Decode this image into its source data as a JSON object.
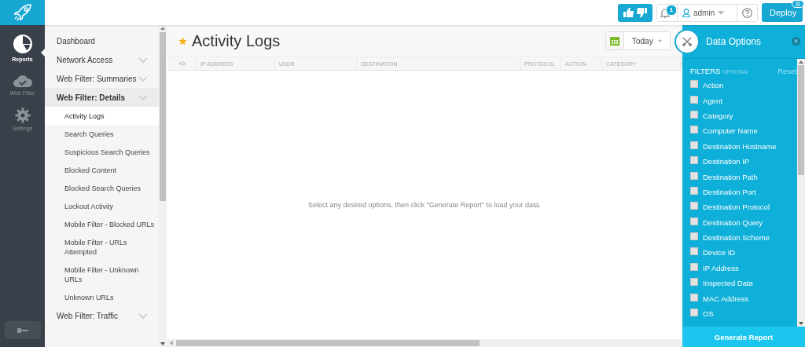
{
  "topbar": {
    "notification_count": "1",
    "user": "admin",
    "deploy_button": "Deploy"
  },
  "rail": [
    {
      "label": "Reports",
      "selected": true
    },
    {
      "label": "Web Filter",
      "selected": false
    },
    {
      "label": "Settings",
      "selected": false
    }
  ],
  "nav": [
    {
      "label": "Dashboard",
      "expandable": false,
      "expanded": false
    },
    {
      "label": "Network Access",
      "expandable": true,
      "expanded": false
    },
    {
      "label": "Web Filter: Summaries",
      "expandable": true,
      "expanded": false
    },
    {
      "label": "Web Filter: Details",
      "expandable": true,
      "expanded": true,
      "children": [
        {
          "label": "Activity Logs",
          "selected": true
        },
        {
          "label": "Search Queries",
          "selected": false
        },
        {
          "label": "Suspicious Search Queries",
          "selected": false
        },
        {
          "label": "Blocked Content",
          "selected": false
        },
        {
          "label": "Blocked Search Queries",
          "selected": false
        },
        {
          "label": "Lockout Activity",
          "selected": false
        },
        {
          "label": "Mobile Filter - Blocked URLs",
          "selected": false
        },
        {
          "label": "Mobile Filter - URLs Attempted",
          "selected": false
        },
        {
          "label": "Mobile Filter - Unknown URLs",
          "selected": false
        },
        {
          "label": "Unknown URLs",
          "selected": false
        }
      ]
    },
    {
      "label": "Web Filter: Traffic",
      "expandable": true,
      "expanded": false
    }
  ],
  "page": {
    "title": "Activity Logs",
    "favorite": true,
    "date_range": "Today"
  },
  "table": {
    "columns": [
      "IP ADDRESS",
      "USER",
      "DESTINATION",
      "PROTOCOL",
      "ACTION",
      "CATEGORY"
    ],
    "empty_message": "Select any desired options, then click \"Generate Report\" to load your data."
  },
  "data_options": {
    "title": "Data Options",
    "section": "FILTERS",
    "section_hint": "OPTIONAL",
    "reset": "Reset",
    "filters": [
      {
        "label": "Action",
        "checked": false
      },
      {
        "label": "Agent",
        "checked": false
      },
      {
        "label": "Category",
        "checked": false
      },
      {
        "label": "Computer Name",
        "checked": false
      },
      {
        "label": "Destination Hostname",
        "checked": false
      },
      {
        "label": "Destination IP",
        "checked": false
      },
      {
        "label": "Destination Path",
        "checked": false
      },
      {
        "label": "Destination Port",
        "checked": false
      },
      {
        "label": "Destination Protocol",
        "checked": false
      },
      {
        "label": "Destination Query",
        "checked": false
      },
      {
        "label": "Destination Scheme",
        "checked": false
      },
      {
        "label": "Device ID",
        "checked": false
      },
      {
        "label": "IP Address",
        "checked": false
      },
      {
        "label": "Inspected Data",
        "checked": false
      },
      {
        "label": "MAC Address",
        "checked": false
      },
      {
        "label": "OS",
        "checked": false
      }
    ],
    "generate_button": "Generate Report"
  }
}
